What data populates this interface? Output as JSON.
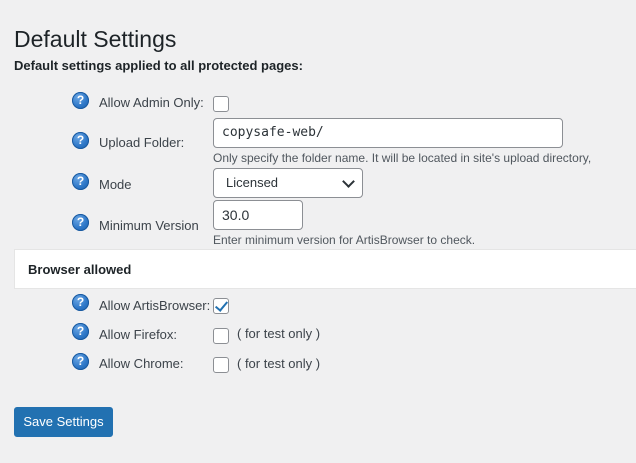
{
  "page": {
    "title": "Default Settings",
    "intro": "Default settings applied to all protected pages:"
  },
  "fields": {
    "admin_only": {
      "label": "Allow Admin Only:",
      "checked": false
    },
    "upload_folder": {
      "label": "Upload Folder:",
      "value": "copysafe-web/",
      "description": "Only specify the folder name. It will be located in site's upload directory,"
    },
    "mode": {
      "label": "Mode",
      "selected": "Licensed"
    },
    "min_version": {
      "label": "Minimum Version",
      "value": "30.0",
      "description": "Enter minimum version for ArtisBrowser to check."
    }
  },
  "browser_section": {
    "title": "Browser allowed",
    "artis": {
      "label": "Allow ArtisBrowser:",
      "checked": true
    },
    "firefox": {
      "label": "Allow Firefox:",
      "checked": false,
      "note": "( for test only )"
    },
    "chrome": {
      "label": "Allow Chrome:",
      "checked": false,
      "note": "( for test only )"
    }
  },
  "help_icon_glyph": "?",
  "actions": {
    "save_label": "Save Settings"
  },
  "colors": {
    "accent": "#2271b1",
    "background": "#f0f0f1"
  }
}
